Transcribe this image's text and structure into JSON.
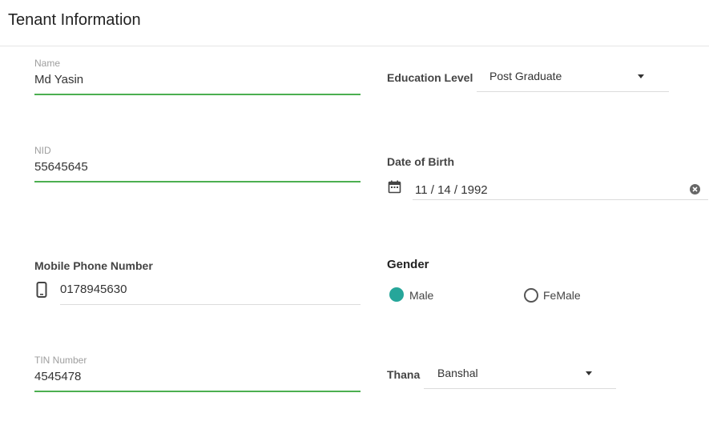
{
  "header": {
    "title": "Tenant Information"
  },
  "fields": {
    "name": {
      "label": "Name",
      "value": "Md Yasin"
    },
    "nid": {
      "label": "NID",
      "value": "55645645"
    },
    "mobile": {
      "label": "Mobile Phone Number",
      "value": "0178945630",
      "icon": "smartphone-icon"
    },
    "tin": {
      "label": "TIN Number",
      "value": "4545478"
    },
    "education": {
      "label": "Education Level",
      "selected": "Post Graduate"
    },
    "dob": {
      "label": "Date of Birth",
      "value": "11 / 14 / 1992",
      "icon": "calendar-icon",
      "clear_icon": "clear-icon"
    },
    "gender": {
      "label": "Gender",
      "options": [
        {
          "label": "Male",
          "selected": true
        },
        {
          "label": "FeMale",
          "selected": false
        }
      ]
    },
    "thana": {
      "label": "Thana",
      "selected": "Banshal"
    }
  },
  "colors": {
    "accent_green": "#4caf50",
    "radio_selected": "#26a69a"
  }
}
